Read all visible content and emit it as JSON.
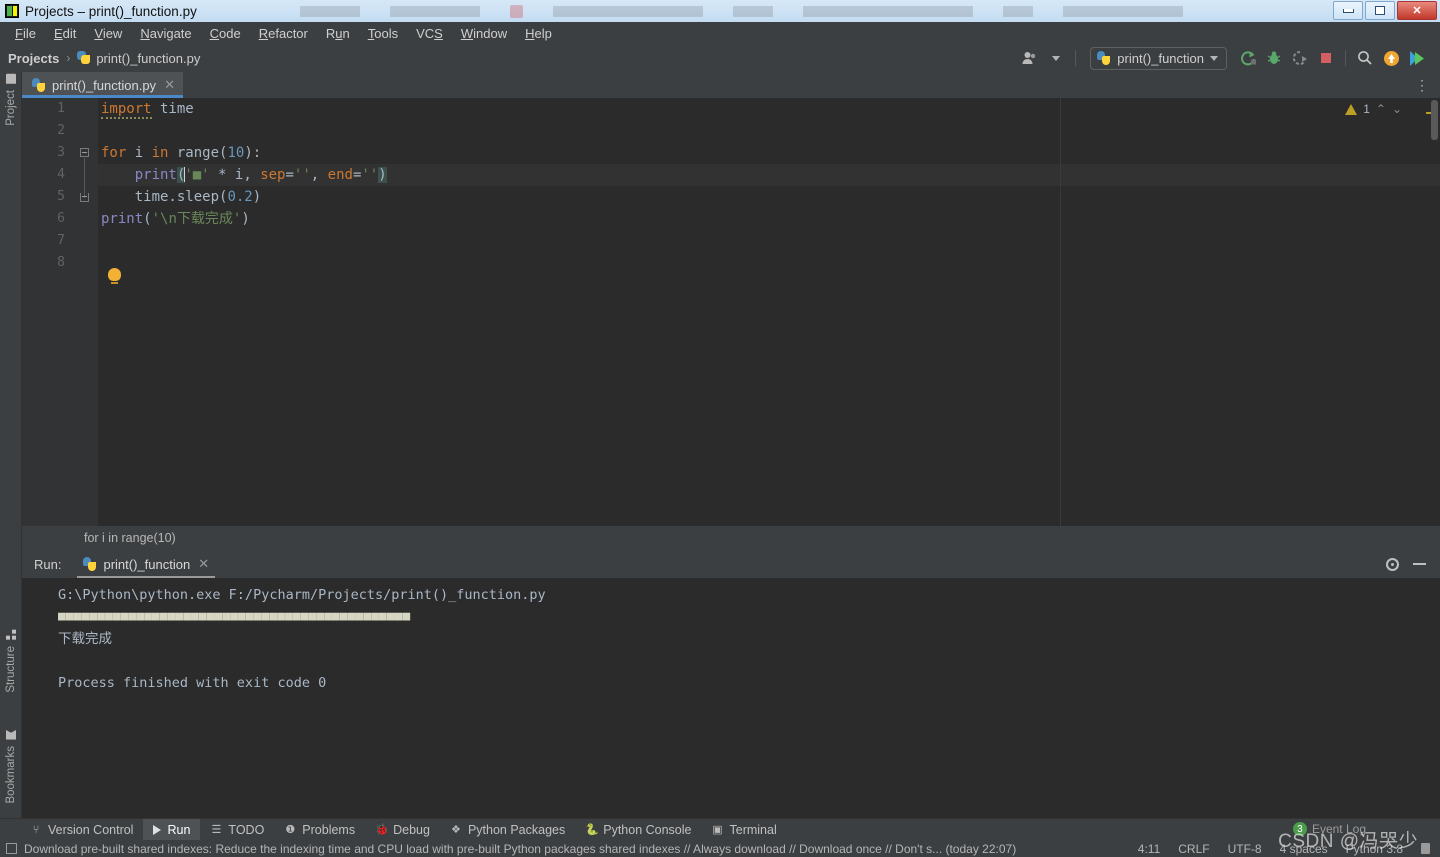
{
  "window": {
    "title": "Projects – print()_function.py",
    "controls": {
      "minimize": "minimize",
      "restore": "restore",
      "close": "✕"
    }
  },
  "menubar": {
    "items": [
      {
        "label": "File",
        "accel": "F"
      },
      {
        "label": "Edit",
        "accel": "E"
      },
      {
        "label": "View",
        "accel": "V"
      },
      {
        "label": "Navigate",
        "accel": "N"
      },
      {
        "label": "Code",
        "accel": "C"
      },
      {
        "label": "Refactor",
        "accel": "R"
      },
      {
        "label": "Run",
        "accel": "u"
      },
      {
        "label": "Tools",
        "accel": "T"
      },
      {
        "label": "VCS",
        "accel": "S"
      },
      {
        "label": "Window",
        "accel": "W"
      },
      {
        "label": "Help",
        "accel": "H"
      }
    ]
  },
  "navbar": {
    "breadcrumb": {
      "project": "Projects",
      "separator": "›",
      "file": "print()_function.py"
    },
    "run_config": "print()_function",
    "icons": {
      "account": "account-icon",
      "run": "run-icon",
      "debug": "debug-icon",
      "coverage": "run-with-coverage-icon",
      "stop": "stop-icon",
      "search": "search-icon",
      "update": "update-project-icon",
      "ide_play": "ide-run-icon"
    }
  },
  "left_strip": {
    "project": "Project",
    "structure": "Structure",
    "bookmarks": "Bookmarks"
  },
  "editor": {
    "tab": {
      "name": "print()_function.py",
      "close": "✕"
    },
    "more_actions": "⋮",
    "line_numbers": [
      "1",
      "2",
      "3",
      "4",
      "5",
      "6",
      "7",
      "8"
    ],
    "warnings": {
      "count": "1",
      "up": "⌃",
      "down": "⌄"
    },
    "code": {
      "line1_kw": "import",
      "line1_mod": " time",
      "line3_for": "for",
      "line3_i": " i ",
      "line3_in": "in",
      "line3_range": " range(",
      "line3_num": "10",
      "line3_end": "):",
      "line4_indent": "    ",
      "line4_fn": "print",
      "line4_open": "(",
      "line4_str1": "'■'",
      "line4_mul": " * i, ",
      "line4_sep": "sep",
      "line4_eq1": "=",
      "line4_str2": "''",
      "line4_comma": ", ",
      "line4_end_kw": "end",
      "line4_eq2": "=",
      "line4_str3": "''",
      "line4_close": ")",
      "line5_indent": "    ",
      "line5_call": "time.sleep(",
      "line5_num": "0.2",
      "line5_close": ")",
      "line6_fn": "print",
      "line6_open": "(",
      "line6_str": "'\\n下载完成'",
      "line6_close": ")"
    }
  },
  "breadcrumb_bar": {
    "text": "for i in range(10)"
  },
  "run_panel": {
    "label": "Run:",
    "tab_name": "print()_function",
    "tab_close": "✕",
    "settings_icon": "gear-icon",
    "minimize_icon": "minimize-icon",
    "console": {
      "command": "G:\\Python\\python.exe F:/Pycharm/Projects/print()_function.py",
      "progress": "■■■■■■■■■■■■■■■■■■■■■■■■■■■■■■■■■■■■■■■■■■■■■",
      "output": "下载完成",
      "blank": "",
      "exit": "Process finished with exit code 0"
    }
  },
  "bottom_tools": [
    {
      "label": "Version Control",
      "icon": "branch-icon",
      "active": false
    },
    {
      "label": "Run",
      "icon": "play-icon",
      "active": true
    },
    {
      "label": "TODO",
      "icon": "list-icon",
      "active": false
    },
    {
      "label": "Problems",
      "icon": "error-icon",
      "active": false
    },
    {
      "label": "Debug",
      "icon": "bug-icon",
      "active": false
    },
    {
      "label": "Python Packages",
      "icon": "packages-icon",
      "active": false
    },
    {
      "label": "Python Console",
      "icon": "python-icon",
      "active": false
    },
    {
      "label": "Terminal",
      "icon": "terminal-icon",
      "active": false
    }
  ],
  "statusbar": {
    "message": "Download pre-built shared indexes: Reduce the indexing time and CPU load with pre-built Python packages shared indexes // Always download // Download once // Don't s... (today 22:07)",
    "caret_position": "4:11",
    "line_separator": "CRLF",
    "encoding": "UTF-8",
    "indent": "4 spaces",
    "interpreter": "Python 3.8",
    "lock_icon": "lock-icon"
  },
  "event_log": {
    "label": "Event Log",
    "count": "3"
  },
  "watermark": {
    "text": "CSDN @冯哭少"
  },
  "colors": {
    "accent": "#4a88c7",
    "editor_bg": "#2b2b2b",
    "panel_bg": "#3c3f41",
    "keyword": "#cc7832",
    "string": "#6a8759",
    "number": "#6897bb",
    "function": "#8888c6",
    "text": "#a9b7c6",
    "warning": "#bba023",
    "success": "#4a9c4a"
  }
}
